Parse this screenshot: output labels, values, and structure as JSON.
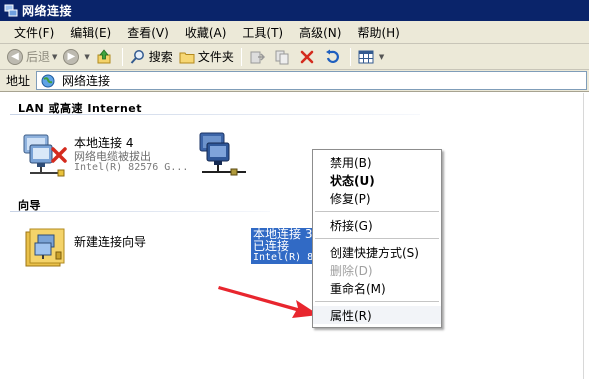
{
  "window": {
    "title": "网络连接"
  },
  "menubar": {
    "items": [
      "文件(F)",
      "编辑(E)",
      "查看(V)",
      "收藏(A)",
      "工具(T)",
      "高级(N)",
      "帮助(H)"
    ]
  },
  "toolbar": {
    "back_label": "后退",
    "search_label": "搜索",
    "folders_label": "文件夹"
  },
  "address": {
    "label": "地址",
    "value": "网络连接"
  },
  "groups": {
    "lan_header": "LAN 或高速 Internet",
    "wizard_header": "向导"
  },
  "connections": [
    {
      "name": "本地连接 4",
      "status": "网络电缆被拔出",
      "device": "Intel(R) 82576 G..."
    },
    {
      "name": "本地连接 3",
      "status": "已连接",
      "device": "Intel(R) 8"
    }
  ],
  "wizard": {
    "label": "新建连接向导"
  },
  "context_menu": {
    "items": [
      {
        "label": "禁用(B)",
        "enabled": true,
        "bold": false
      },
      {
        "label": "状态(U)",
        "enabled": true,
        "bold": true
      },
      {
        "label": "修复(P)",
        "enabled": true,
        "bold": false
      },
      {
        "label": "桥接(G)",
        "enabled": true,
        "bold": false
      },
      {
        "label": "创建快捷方式(S)",
        "enabled": true,
        "bold": false
      },
      {
        "label": "删除(D)",
        "enabled": false,
        "bold": false
      },
      {
        "label": "重命名(M)",
        "enabled": true,
        "bold": false
      },
      {
        "label": "属性(R)",
        "enabled": true,
        "bold": false
      }
    ]
  },
  "colors": {
    "titlebar": "#0a246a",
    "selection": "#316ac5",
    "annotation_arrow": "#e8262e",
    "chrome": "#ece9d8"
  }
}
